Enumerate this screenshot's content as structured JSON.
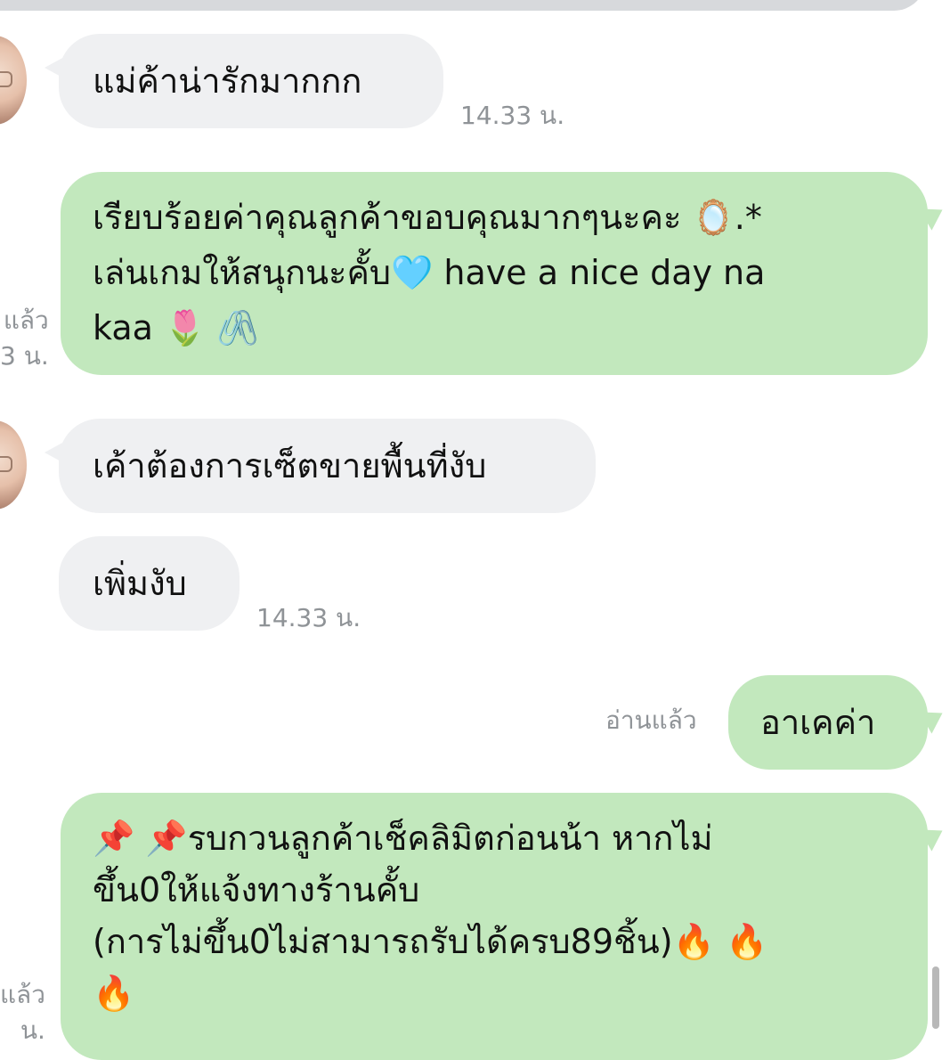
{
  "chat": {
    "messages": [
      {
        "side": "in",
        "text": "แม่ค้าน่ารักมากกก",
        "time": "14.33 น."
      },
      {
        "side": "out",
        "lines": [
          "เรียบร้อยค่าคุณลูกค้าขอบคุณมากๆนะคะ 🪞.*",
          "เล่นเกมให้สนุกนะคั้บ🩵 have a nice day na",
          "kaa 🌷 🖇️"
        ],
        "status_read": "แล้ว",
        "status_time": "3 น."
      },
      {
        "side": "in",
        "text": "เค้าต้องการเซ็ตขายพื้นที่งับ"
      },
      {
        "side": "in",
        "text": "เพิ่มงับ",
        "time": "14.33 น."
      },
      {
        "side": "out",
        "text": "อาเคค่า",
        "status_read": "อ่านแล้ว"
      },
      {
        "side": "out",
        "lines": [
          "📌 📌รบกวนลูกค้าเช็คลิมิตก่อนน้า หากไม่",
          "ขึ้น0ให้แจ้งทางร้านคั้บ",
          "(การไม่ขึ้น0ไม่สามารถรับได้ครบ89ชิ้น)🔥 🔥",
          "🔥"
        ],
        "status_read": "แล้ว",
        "status_time": "น."
      }
    ]
  },
  "colors": {
    "incoming_bubble": "#eff0f2",
    "outgoing_bubble": "#c2e8bd",
    "meta_text": "#8f9397",
    "top_bar": "#d7d9dc"
  },
  "icons": {
    "avatar": "user-avatar-photo"
  }
}
